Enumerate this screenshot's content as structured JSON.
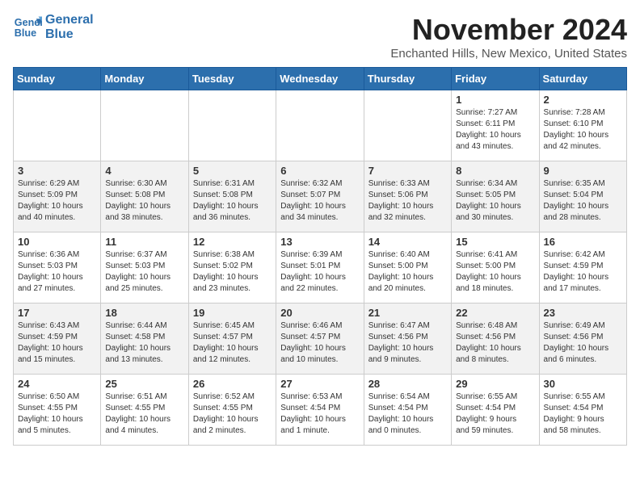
{
  "logo": {
    "line1": "General",
    "line2": "Blue"
  },
  "title": "November 2024",
  "location": "Enchanted Hills, New Mexico, United States",
  "days_of_week": [
    "Sunday",
    "Monday",
    "Tuesday",
    "Wednesday",
    "Thursday",
    "Friday",
    "Saturday"
  ],
  "weeks": [
    [
      {
        "day": "",
        "info": ""
      },
      {
        "day": "",
        "info": ""
      },
      {
        "day": "",
        "info": ""
      },
      {
        "day": "",
        "info": ""
      },
      {
        "day": "",
        "info": ""
      },
      {
        "day": "1",
        "info": "Sunrise: 7:27 AM\nSunset: 6:11 PM\nDaylight: 10 hours\nand 43 minutes."
      },
      {
        "day": "2",
        "info": "Sunrise: 7:28 AM\nSunset: 6:10 PM\nDaylight: 10 hours\nand 42 minutes."
      }
    ],
    [
      {
        "day": "3",
        "info": "Sunrise: 6:29 AM\nSunset: 5:09 PM\nDaylight: 10 hours\nand 40 minutes."
      },
      {
        "day": "4",
        "info": "Sunrise: 6:30 AM\nSunset: 5:08 PM\nDaylight: 10 hours\nand 38 minutes."
      },
      {
        "day": "5",
        "info": "Sunrise: 6:31 AM\nSunset: 5:08 PM\nDaylight: 10 hours\nand 36 minutes."
      },
      {
        "day": "6",
        "info": "Sunrise: 6:32 AM\nSunset: 5:07 PM\nDaylight: 10 hours\nand 34 minutes."
      },
      {
        "day": "7",
        "info": "Sunrise: 6:33 AM\nSunset: 5:06 PM\nDaylight: 10 hours\nand 32 minutes."
      },
      {
        "day": "8",
        "info": "Sunrise: 6:34 AM\nSunset: 5:05 PM\nDaylight: 10 hours\nand 30 minutes."
      },
      {
        "day": "9",
        "info": "Sunrise: 6:35 AM\nSunset: 5:04 PM\nDaylight: 10 hours\nand 28 minutes."
      }
    ],
    [
      {
        "day": "10",
        "info": "Sunrise: 6:36 AM\nSunset: 5:03 PM\nDaylight: 10 hours\nand 27 minutes."
      },
      {
        "day": "11",
        "info": "Sunrise: 6:37 AM\nSunset: 5:03 PM\nDaylight: 10 hours\nand 25 minutes."
      },
      {
        "day": "12",
        "info": "Sunrise: 6:38 AM\nSunset: 5:02 PM\nDaylight: 10 hours\nand 23 minutes."
      },
      {
        "day": "13",
        "info": "Sunrise: 6:39 AM\nSunset: 5:01 PM\nDaylight: 10 hours\nand 22 minutes."
      },
      {
        "day": "14",
        "info": "Sunrise: 6:40 AM\nSunset: 5:00 PM\nDaylight: 10 hours\nand 20 minutes."
      },
      {
        "day": "15",
        "info": "Sunrise: 6:41 AM\nSunset: 5:00 PM\nDaylight: 10 hours\nand 18 minutes."
      },
      {
        "day": "16",
        "info": "Sunrise: 6:42 AM\nSunset: 4:59 PM\nDaylight: 10 hours\nand 17 minutes."
      }
    ],
    [
      {
        "day": "17",
        "info": "Sunrise: 6:43 AM\nSunset: 4:59 PM\nDaylight: 10 hours\nand 15 minutes."
      },
      {
        "day": "18",
        "info": "Sunrise: 6:44 AM\nSunset: 4:58 PM\nDaylight: 10 hours\nand 13 minutes."
      },
      {
        "day": "19",
        "info": "Sunrise: 6:45 AM\nSunset: 4:57 PM\nDaylight: 10 hours\nand 12 minutes."
      },
      {
        "day": "20",
        "info": "Sunrise: 6:46 AM\nSunset: 4:57 PM\nDaylight: 10 hours\nand 10 minutes."
      },
      {
        "day": "21",
        "info": "Sunrise: 6:47 AM\nSunset: 4:56 PM\nDaylight: 10 hours\nand 9 minutes."
      },
      {
        "day": "22",
        "info": "Sunrise: 6:48 AM\nSunset: 4:56 PM\nDaylight: 10 hours\nand 8 minutes."
      },
      {
        "day": "23",
        "info": "Sunrise: 6:49 AM\nSunset: 4:56 PM\nDaylight: 10 hours\nand 6 minutes."
      }
    ],
    [
      {
        "day": "24",
        "info": "Sunrise: 6:50 AM\nSunset: 4:55 PM\nDaylight: 10 hours\nand 5 minutes."
      },
      {
        "day": "25",
        "info": "Sunrise: 6:51 AM\nSunset: 4:55 PM\nDaylight: 10 hours\nand 4 minutes."
      },
      {
        "day": "26",
        "info": "Sunrise: 6:52 AM\nSunset: 4:55 PM\nDaylight: 10 hours\nand 2 minutes."
      },
      {
        "day": "27",
        "info": "Sunrise: 6:53 AM\nSunset: 4:54 PM\nDaylight: 10 hours\nand 1 minute."
      },
      {
        "day": "28",
        "info": "Sunrise: 6:54 AM\nSunset: 4:54 PM\nDaylight: 10 hours\nand 0 minutes."
      },
      {
        "day": "29",
        "info": "Sunrise: 6:55 AM\nSunset: 4:54 PM\nDaylight: 9 hours\nand 59 minutes."
      },
      {
        "day": "30",
        "info": "Sunrise: 6:55 AM\nSunset: 4:54 PM\nDaylight: 9 hours\nand 58 minutes."
      }
    ]
  ]
}
